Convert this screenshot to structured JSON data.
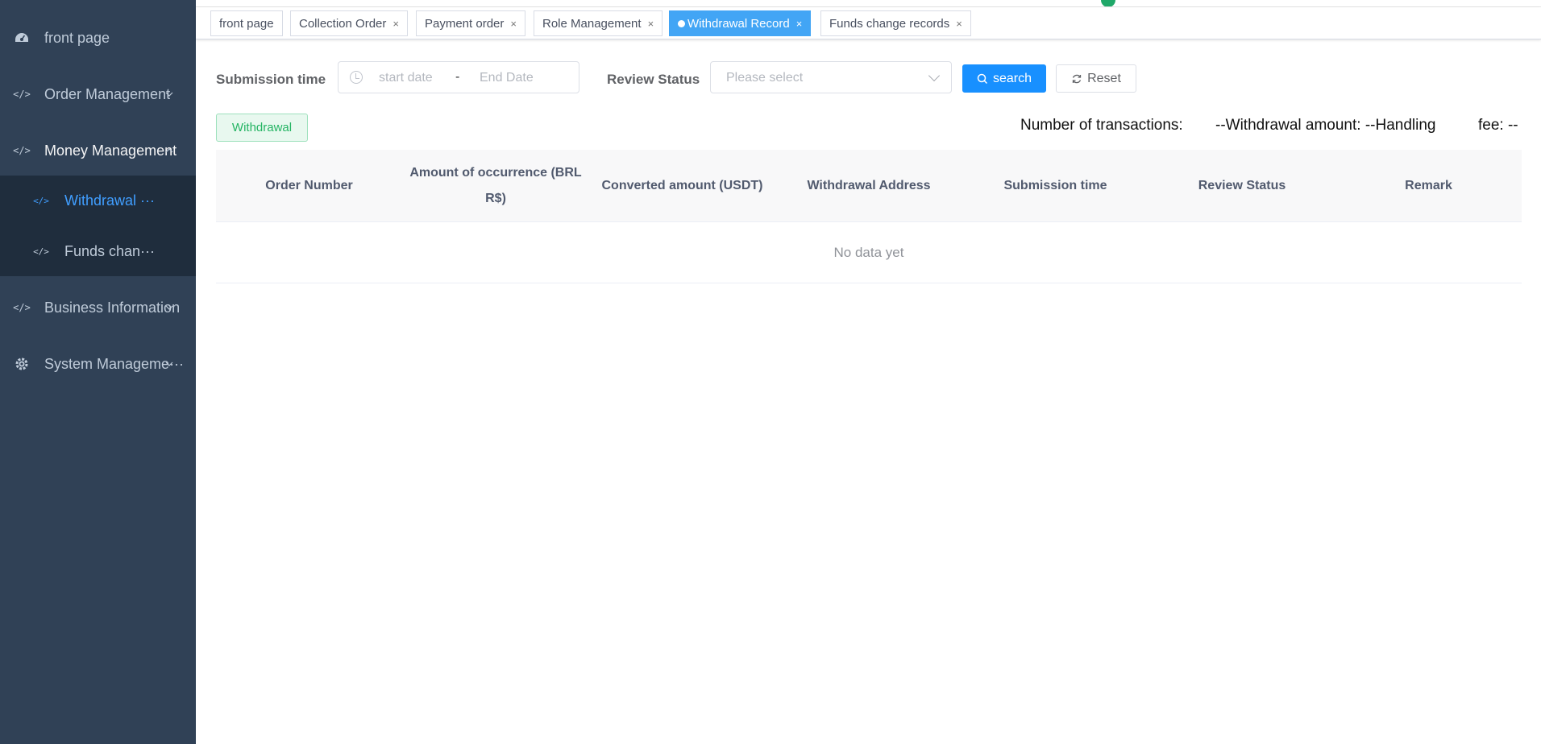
{
  "sidebar": {
    "items": [
      {
        "label": "front page",
        "icon": "dashboard-icon"
      },
      {
        "label": "Order Management",
        "icon": "code-icon"
      },
      {
        "label": "Money Management",
        "icon": "code-icon"
      },
      {
        "label": "Business Information",
        "icon": "code-icon"
      },
      {
        "label": "System Manageme···",
        "icon": "gear-icon"
      }
    ],
    "submenu": [
      {
        "label": "Withdrawal ···",
        "active": true
      },
      {
        "label": "Funds chan···",
        "active": false
      }
    ]
  },
  "tabs": [
    {
      "label": "front page"
    },
    {
      "label": "Collection Order"
    },
    {
      "label": "Payment order"
    },
    {
      "label": "Role Management"
    },
    {
      "label": "Withdrawal Record",
      "active": true
    },
    {
      "label": "Funds change records"
    }
  ],
  "filters": {
    "submission_time_label": "Submission time",
    "start_placeholder": "start date",
    "range_separator": "-",
    "end_placeholder": "End Date",
    "review_status_label": "Review Status",
    "select_placeholder": "Please select",
    "search_label": "search",
    "reset_label": "Reset"
  },
  "toolbar": {
    "withdrawal_button": "Withdrawal",
    "stats_count_label": "Number of transactions:",
    "stats_amount_label": "--Withdrawal amount: --Handling",
    "stats_fee_label": "fee: --"
  },
  "table": {
    "columns": [
      "Order Number",
      "Amount of occurrence (BRL R$)",
      "Converted amount (USDT)",
      "Withdrawal Address",
      "Submission time",
      "Review Status",
      "Remark"
    ],
    "empty_text": "No data yet"
  },
  "colors": {
    "sidebar_bg": "#304156",
    "submenu_bg": "#1f2d3d",
    "accent": "#409eff",
    "primary_button": "#1890ff",
    "active_tab": "#42a5f5",
    "success": "#24b463"
  }
}
